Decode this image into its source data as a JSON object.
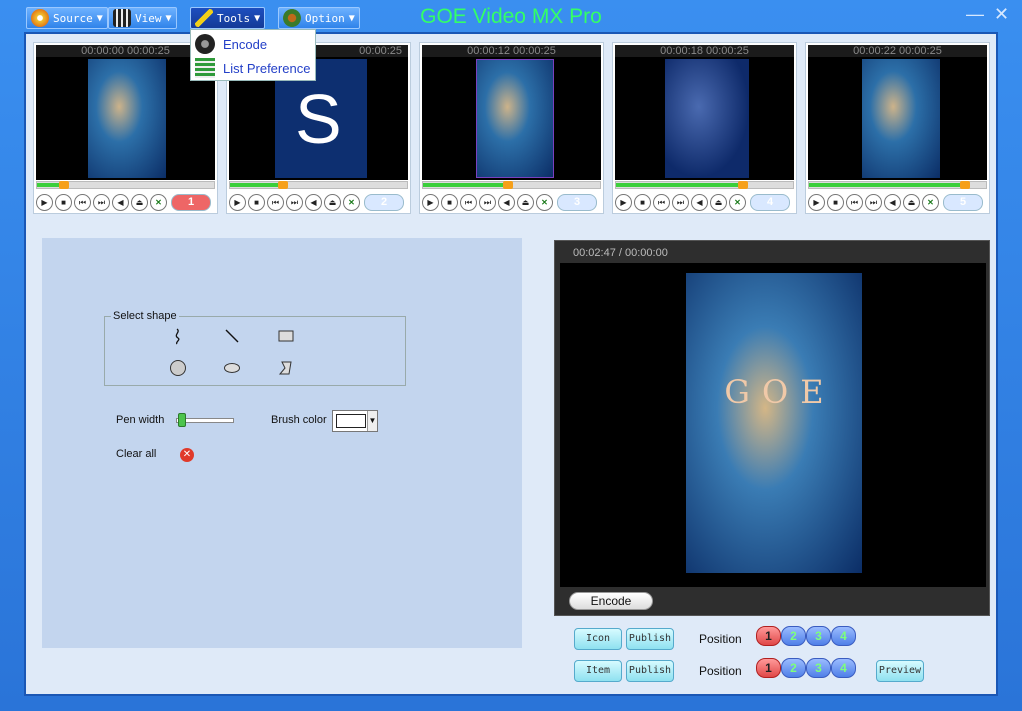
{
  "app": {
    "title": "GOE Video MX Pro",
    "minimize": "—",
    "close": "✕"
  },
  "menu": [
    {
      "label": "Source",
      "icon": "disc-icon"
    },
    {
      "label": "View",
      "icon": "film-icon"
    },
    {
      "label": "Tools",
      "icon": "wrench-icon"
    },
    {
      "label": "Option",
      "icon": "gear-icon"
    }
  ],
  "tools_menu": {
    "items": [
      {
        "label": "Encode",
        "icon": "encode-icon"
      },
      {
        "label": "List Preference",
        "icon": "list-icon"
      }
    ]
  },
  "thumbnails": [
    {
      "time": "00:00:00 00:00:25",
      "slot": "1",
      "progress": 0.15
    },
    {
      "time": "00:00:25",
      "slot": "2",
      "progress": 0.3
    },
    {
      "time": "00:00:12 00:00:25",
      "slot": "3",
      "progress": 0.48
    },
    {
      "time": "00:00:18 00:00:25",
      "slot": "4",
      "progress": 0.72
    },
    {
      "time": "00:00:22 00:00:25",
      "slot": "5",
      "progress": 0.88
    }
  ],
  "draw": {
    "select_shape": "Select shape",
    "pen_width": "Pen width",
    "brush_color": "Brush color",
    "clear_all": "Clear all",
    "brush_color_value": "#ffffff"
  },
  "preview": {
    "time": "00:02:47 / 00:00:00",
    "overlay_text": "GOE",
    "encode": "Encode"
  },
  "bottom": {
    "row1": {
      "left": "Icon",
      "right": "Publish",
      "position_label": "Position"
    },
    "row2": {
      "left": "Item",
      "right": "Publish",
      "position_label": "Position"
    },
    "positions": [
      "1",
      "2",
      "3",
      "4"
    ],
    "preview": "Preview"
  }
}
